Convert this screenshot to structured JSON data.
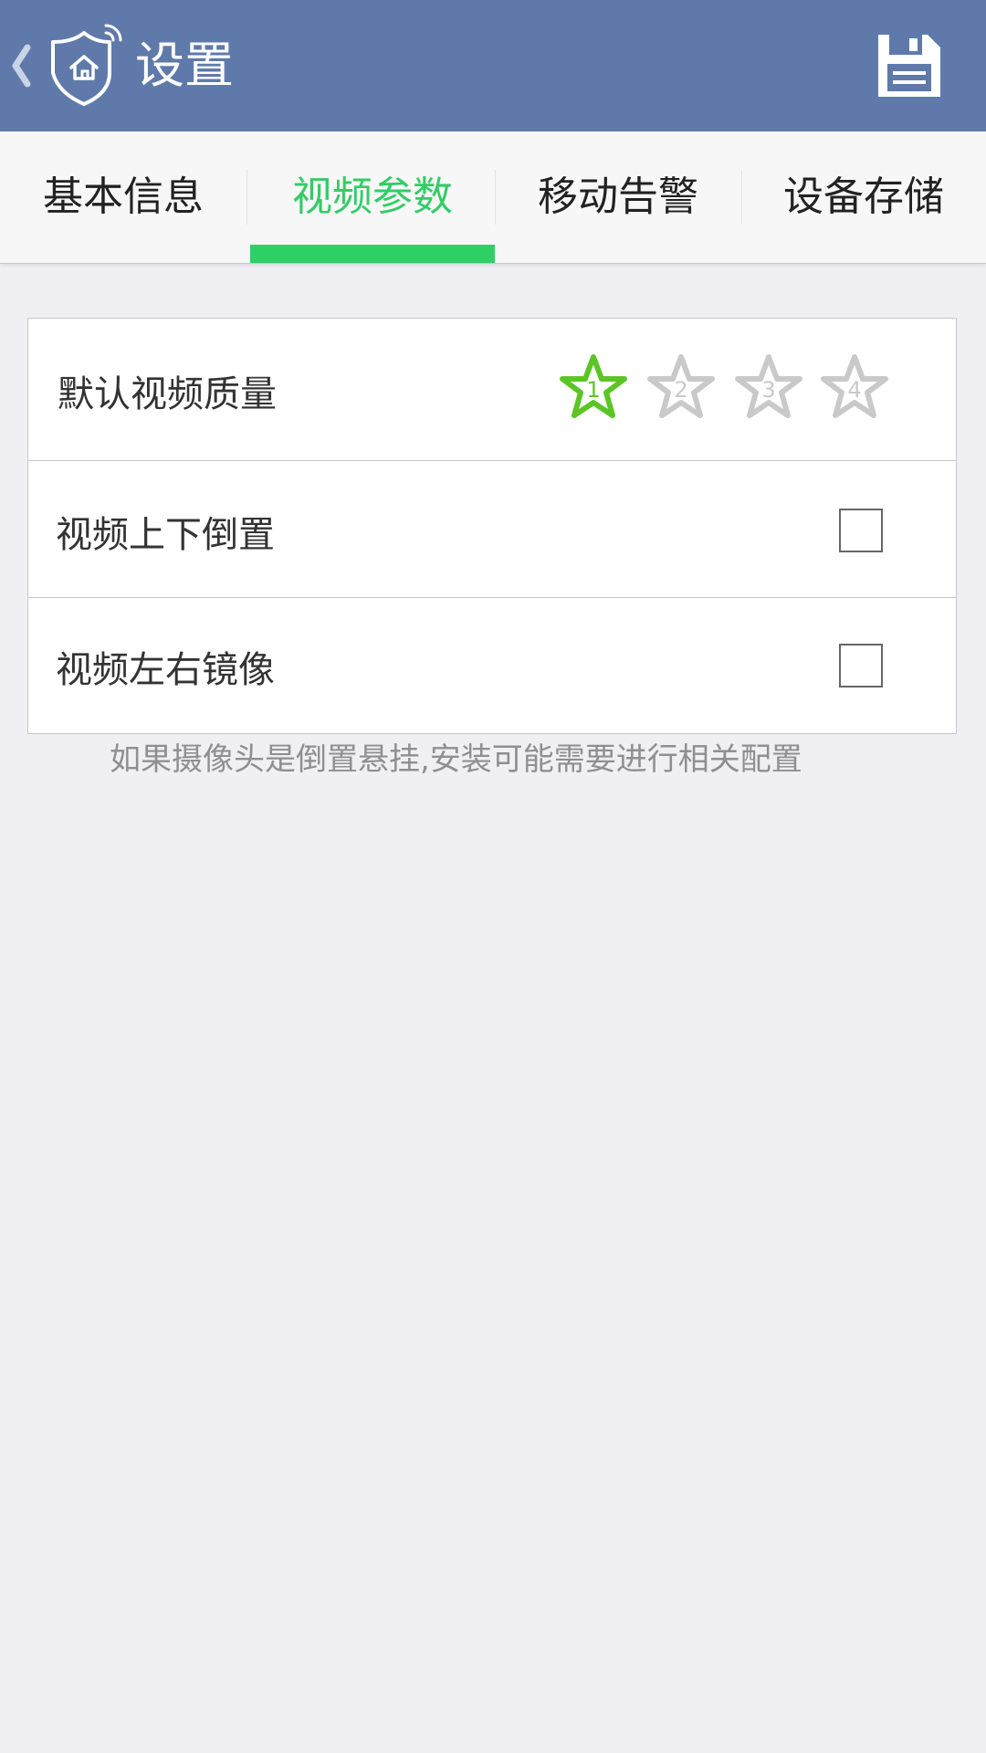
{
  "header": {
    "title": "设置",
    "back_icon": "chevron-left-icon",
    "logo_icon": "home-shield-wifi-icon",
    "save_icon": "floppy-disk-icon",
    "background_color": "#5f7aaa"
  },
  "tabs": [
    {
      "label": "基本信息",
      "active": false
    },
    {
      "label": "视频参数",
      "active": true
    },
    {
      "label": "移动告警",
      "active": false
    },
    {
      "label": "设备存储",
      "active": false
    }
  ],
  "accent_color": "#2ed065",
  "settings": {
    "video_quality": {
      "label": "默认视频质量",
      "options": [
        "1",
        "2",
        "3",
        "4"
      ],
      "selected": "1"
    },
    "flip_vertical": {
      "label": "视频上下倒置",
      "checked": false
    },
    "mirror_horizontal": {
      "label": "视频左右镜像",
      "checked": false
    }
  },
  "hint": "如果摄像头是倒置悬挂,安装可能需要进行相关配置"
}
